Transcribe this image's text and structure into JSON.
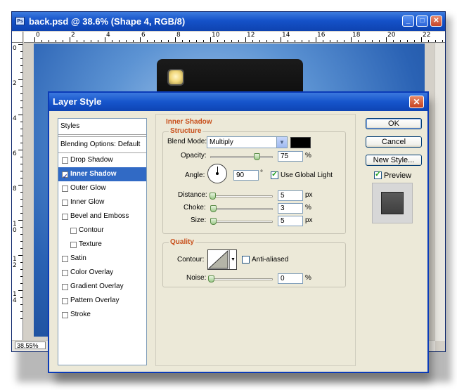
{
  "document": {
    "title": "back.psd @ 38.6% (Shape 4, RGB/8)",
    "zoom": "38.55%",
    "ruler_top_labels": [
      "0",
      "2",
      "4",
      "6",
      "8",
      "10",
      "12",
      "14",
      "16",
      "18",
      "20",
      "22"
    ],
    "ruler_left_labels": [
      "0",
      "2",
      "4",
      "6",
      "8",
      "1\n0",
      "1\n2",
      "1\n4"
    ],
    "window_buttons": {
      "minimize": "_",
      "maximize": "□",
      "close": "✕"
    }
  },
  "dialog": {
    "title": "Layer Style",
    "close_label": "✕",
    "sidebar": {
      "styles_label": "Styles",
      "blending_label": "Blending Options: Default",
      "items": [
        {
          "label": "Drop Shadow",
          "checked": false,
          "indent": false,
          "selected": false
        },
        {
          "label": "Inner Shadow",
          "checked": true,
          "indent": false,
          "selected": true
        },
        {
          "label": "Outer Glow",
          "checked": false,
          "indent": false,
          "selected": false
        },
        {
          "label": "Inner Glow",
          "checked": false,
          "indent": false,
          "selected": false
        },
        {
          "label": "Bevel and Emboss",
          "checked": false,
          "indent": false,
          "selected": false
        },
        {
          "label": "Contour",
          "checked": false,
          "indent": true,
          "selected": false
        },
        {
          "label": "Texture",
          "checked": false,
          "indent": true,
          "selected": false
        },
        {
          "label": "Satin",
          "checked": false,
          "indent": false,
          "selected": false
        },
        {
          "label": "Color Overlay",
          "checked": false,
          "indent": false,
          "selected": false
        },
        {
          "label": "Gradient Overlay",
          "checked": false,
          "indent": false,
          "selected": false
        },
        {
          "label": "Pattern Overlay",
          "checked": false,
          "indent": false,
          "selected": false
        },
        {
          "label": "Stroke",
          "checked": false,
          "indent": false,
          "selected": false
        }
      ]
    },
    "inner_shadow": {
      "section_title": "Inner Shadow",
      "structure": {
        "title": "Structure",
        "blend_mode_label": "Blend Mode:",
        "blend_mode_value": "Multiply",
        "blend_color": "#000000",
        "opacity_label": "Opacity:",
        "opacity_value": "75",
        "opacity_unit": "%",
        "angle_label": "Angle:",
        "angle_value": "90",
        "angle_unit": "°",
        "global_light_label": "Use Global Light",
        "global_light_checked": true,
        "distance_label": "Distance:",
        "distance_value": "5",
        "distance_unit": "px",
        "choke_label": "Choke:",
        "choke_value": "3",
        "choke_unit": "%",
        "size_label": "Size:",
        "size_value": "5",
        "size_unit": "px"
      },
      "quality": {
        "title": "Quality",
        "contour_label": "Contour:",
        "anti_aliased_label": "Anti-aliased",
        "anti_aliased_checked": false,
        "noise_label": "Noise:",
        "noise_value": "0",
        "noise_unit": "%"
      }
    },
    "buttons": {
      "ok": "OK",
      "cancel": "Cancel",
      "new_style": "New Style...",
      "preview_label": "Preview",
      "preview_checked": true
    }
  },
  "colors": {
    "titlebar_blue": "#1655cc",
    "selection_blue": "#316ac5",
    "section_orange": "#c8501c"
  }
}
